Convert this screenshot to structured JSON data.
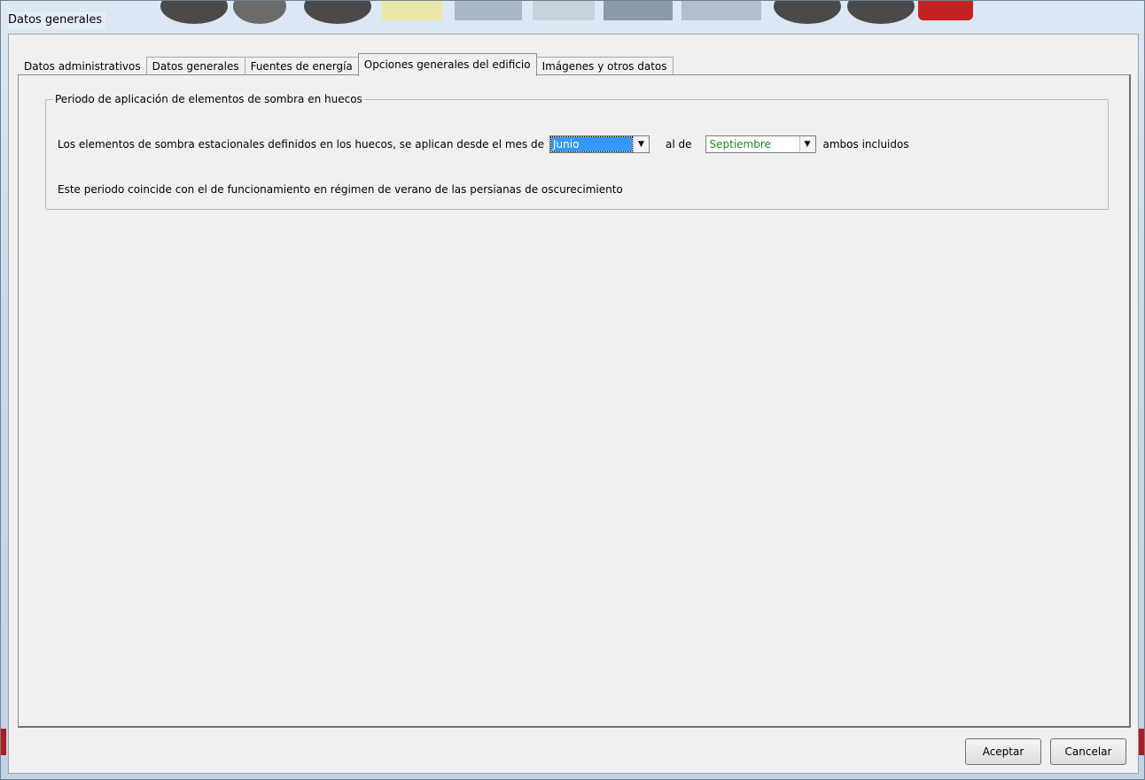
{
  "window": {
    "title": "Datos generales"
  },
  "tabs": [
    {
      "label": "Datos administrativos",
      "active": false
    },
    {
      "label": "Datos generales",
      "active": false
    },
    {
      "label": "Fuentes de energía",
      "active": false
    },
    {
      "label": "Opciones generales del edificio",
      "active": true
    },
    {
      "label": "Imágenes y otros datos",
      "active": false
    }
  ],
  "shading_group": {
    "title": "Periodo de aplicación de elementos de sombra en huecos",
    "sentence_start": "Los elementos de sombra estacionales definidos en los huecos, se aplican desde el mes de",
    "from_month": "Junio",
    "connector": "al de",
    "to_month": "Septiembre",
    "sentence_end": "ambos incluidos",
    "note": "Este periodo coincide con el de funcionamiento en régimen de verano de las persianas de oscurecimiento"
  },
  "buttons": {
    "accept": "Aceptar",
    "cancel": "Cancelar"
  },
  "colors": {
    "selection": "#3399ff",
    "to_month_text": "#1a8a1a"
  }
}
